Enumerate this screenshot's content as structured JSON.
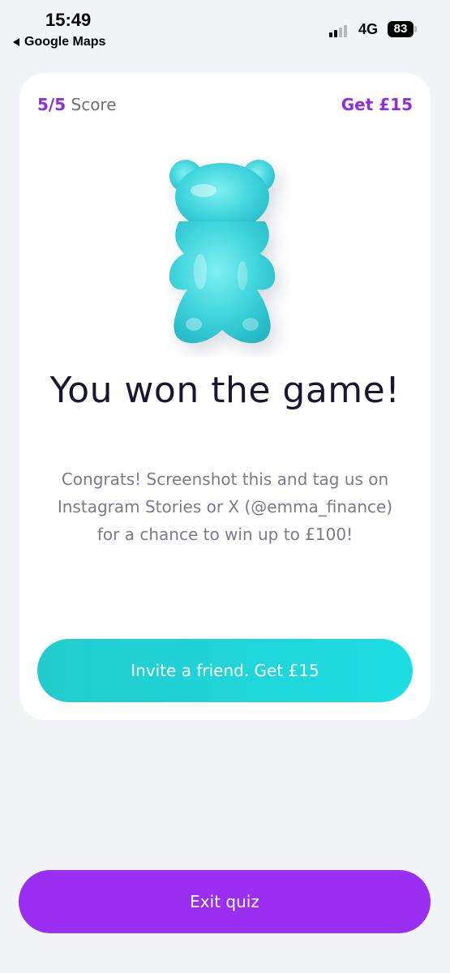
{
  "status_bar": {
    "time": "15:49",
    "back_app": "Google Maps",
    "network": "4G",
    "battery": "83"
  },
  "card": {
    "score_value": "5/5",
    "score_label": "Score",
    "reward": "Get £15",
    "title": "You won the game!",
    "description": "Congrats! Screenshot this and tag us on Instagram Stories or X (@emma_finance) for a chance to win up to £100!",
    "invite_button": "Invite a friend. Get £15"
  },
  "footer": {
    "exit_button": "Exit quiz"
  },
  "colors": {
    "accent_purple": "#9a2ff2",
    "accent_teal": "#1ed6dc",
    "background": "#f3f4f8"
  }
}
